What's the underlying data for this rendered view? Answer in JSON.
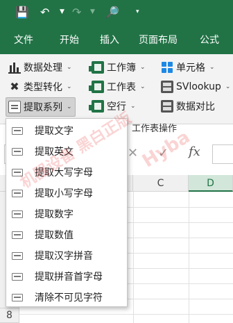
{
  "titlebar": {
    "icons": [
      "save-icon",
      "undo-icon",
      "redo-icon",
      "print-preview-icon",
      "customize-toolbar-icon"
    ]
  },
  "menu": {
    "tabs": [
      "文件",
      "开始",
      "插入",
      "页面布局",
      "公式"
    ]
  },
  "ribbon": {
    "row1": [
      "数据处理",
      "工作簿",
      "单元格"
    ],
    "row2": [
      "类型转化",
      "工作表",
      "SVlookup"
    ],
    "row3": [
      "提取系列",
      "空行",
      "数据对比"
    ],
    "group_label": "工作表操作"
  },
  "formula_bar": {
    "fx_label": "fx"
  },
  "grid": {
    "columns": [
      "C",
      "D"
    ],
    "visible_row": "8"
  },
  "dropdown": {
    "items": [
      "提取文字",
      "提取英文",
      "提取大写字母",
      "提取小写字母",
      "提取数字",
      "提取数值",
      "提取汉字拼音",
      "提取拼音首字母",
      "清除不可见字符"
    ]
  },
  "watermarks": [
    "机器设备 黑白正版",
    "Hyba"
  ],
  "colors": {
    "accent": "#217346",
    "ribbon_bg": "#f3f3f3",
    "selected_column": "#d2e6d9"
  }
}
